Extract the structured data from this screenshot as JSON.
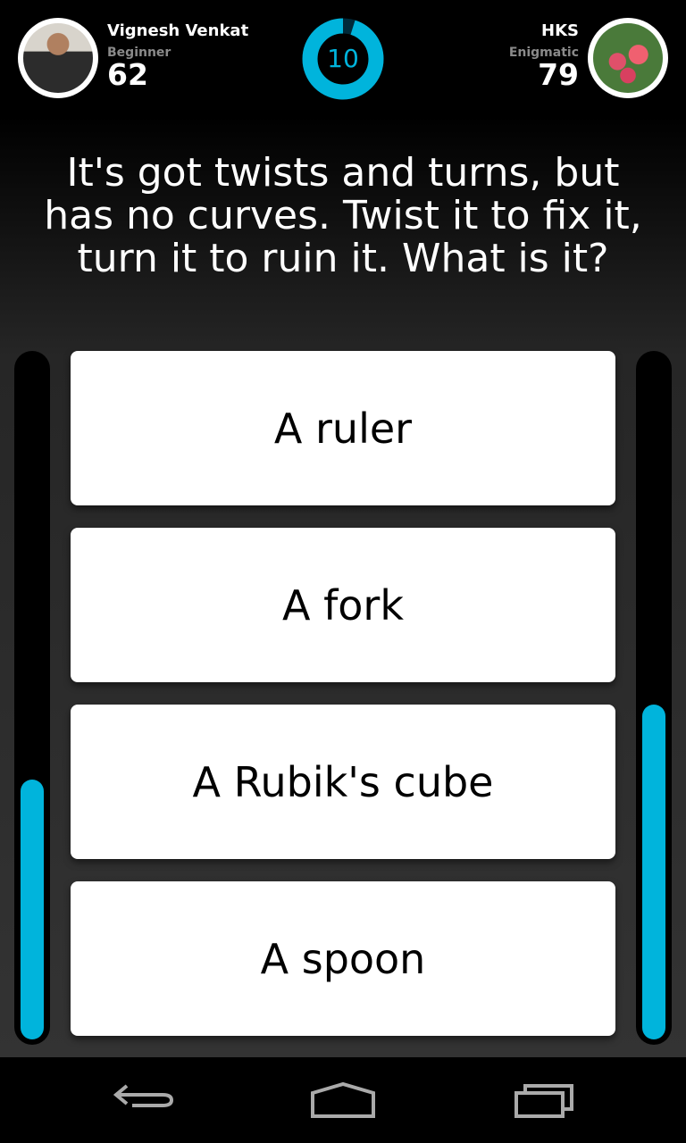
{
  "player1": {
    "name": "Vignesh Venkat",
    "rank": "Beginner",
    "score": "62",
    "progress": 0.38
  },
  "player2": {
    "name": "HKS",
    "rank": "Enigmatic",
    "score": "79",
    "progress": 0.49
  },
  "timer": {
    "value": "10",
    "fraction_remaining": 0.95,
    "color": "#00b4dc"
  },
  "question": "It's got twists and turns, but has no curves. Twist it to fix it, turn it to ruin it. What is it?",
  "answers": [
    "A ruler",
    "A fork",
    "A Rubik's cube",
    "A spoon"
  ],
  "nav": {
    "icons": [
      "back-icon",
      "home-icon",
      "recent-apps-icon"
    ]
  }
}
